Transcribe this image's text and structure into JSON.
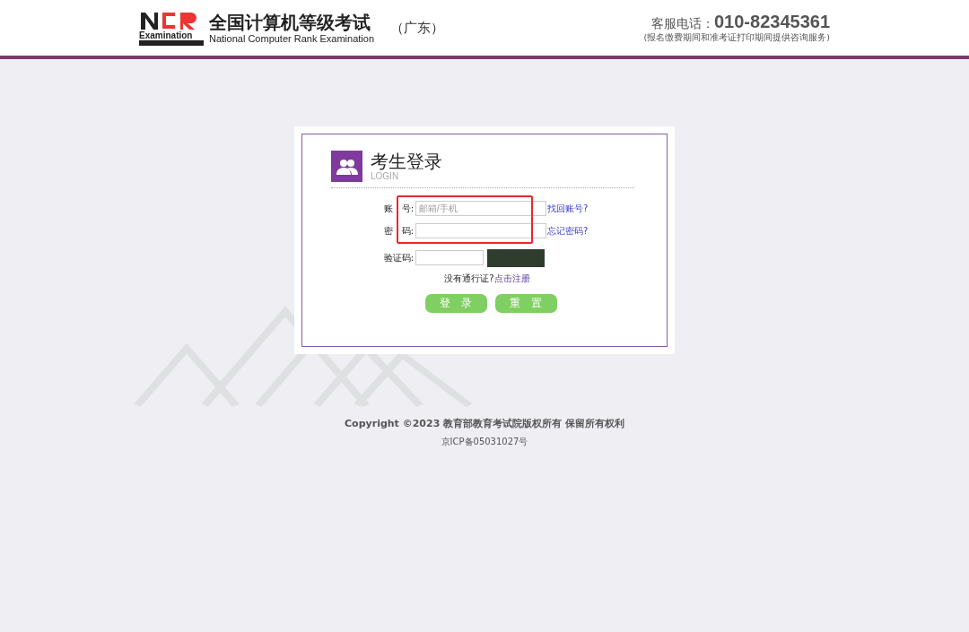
{
  "header": {
    "logo_word": "Examination",
    "title": "全国计算机等级考试",
    "subtitle": "National Computer Rank Examination",
    "region": "（广东）",
    "hotline_label": "客服电话：",
    "hotline_number": "010-82345361",
    "hotline_note": "(报名缴费期间和准考证打印期间提供咨询服务)"
  },
  "login": {
    "title": "考生登录",
    "subtitle": "LOGIN",
    "fields": [
      {
        "kind": "text",
        "label": "账　号:",
        "placeholder": "邮箱/手机",
        "link": "找回账号?",
        "highlighted": true
      },
      {
        "kind": "password",
        "label": "密　码:",
        "link": "忘记密码?",
        "highlighted": true
      },
      {
        "kind": "captcha",
        "label": "验证码:",
        "highlighted": false
      }
    ],
    "register_prompt": "没有通行证?",
    "register_link": "点击注册",
    "buttons": [
      "登　录",
      "重　置"
    ]
  },
  "footer": {
    "copyright": "Copyright ©2023 教育部教育考试院版权所有 保留所有权利",
    "icp": "京ICP备05031027号"
  }
}
